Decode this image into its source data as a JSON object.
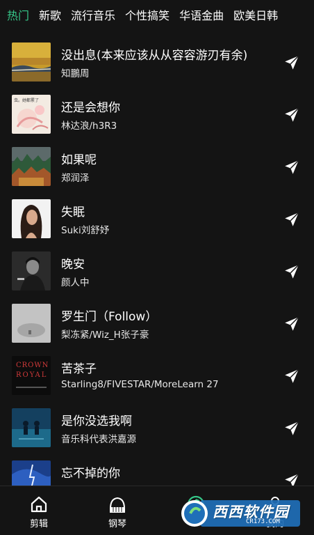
{
  "tabs": [
    {
      "label": "热门",
      "active": true
    },
    {
      "label": "新歌",
      "active": false
    },
    {
      "label": "流行音乐",
      "active": false
    },
    {
      "label": "个性搞笑",
      "active": false
    },
    {
      "label": "华语金曲",
      "active": false
    },
    {
      "label": "欧美日韩",
      "active": false
    }
  ],
  "songs": [
    {
      "title": "没出息(本来应该从从容容游刃有余)",
      "artist": "知鵬周"
    },
    {
      "title": "还是会想你",
      "artist": "林达浪/h3R3"
    },
    {
      "title": "如果呢",
      "artist": "郑润泽"
    },
    {
      "title": "失眠",
      "artist": "Suki刘舒妤"
    },
    {
      "title": "晚安",
      "artist": "颜人中"
    },
    {
      "title": "罗生门（Follow）",
      "artist": "梨冻紧/Wiz_H张子豪"
    },
    {
      "title": "苦茶子",
      "artist": "Starling8/FIVESTAR/MoreLearn 27"
    },
    {
      "title": "是你没选我啊",
      "artist": "音乐科代表洪嘉源"
    },
    {
      "title": "忘不掉的你",
      "artist": ""
    }
  ],
  "covers": {
    "song2_text": "虫。她都累了",
    "song7_text": [
      "CROWN",
      "ROYAL"
    ]
  },
  "bottom_nav": [
    {
      "label": "剪辑",
      "icon": "home-icon"
    },
    {
      "label": "钢琴",
      "icon": "piano-icon"
    },
    {
      "label": "",
      "icon": "music-icon"
    },
    {
      "label": "我的",
      "icon": "profile-icon"
    }
  ],
  "watermark": {
    "text": "西西软件园",
    "url": "CR173.COM"
  },
  "colors": {
    "accent": "#36c98a",
    "background": "#141414"
  }
}
